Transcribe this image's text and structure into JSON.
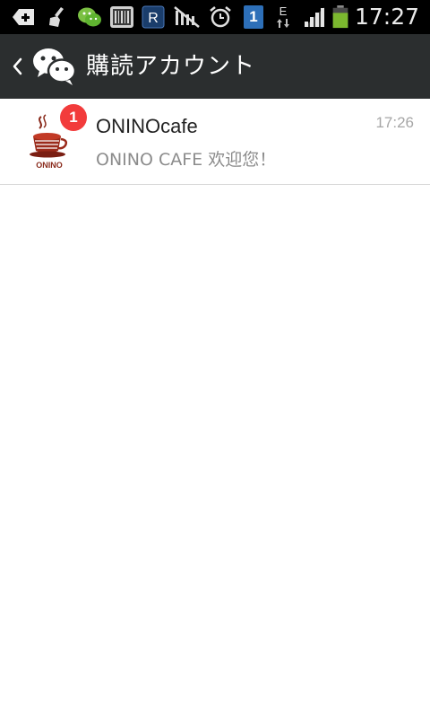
{
  "status_bar": {
    "time": "17:27",
    "icons": [
      "android-icon",
      "broom-icon",
      "wechat-icon",
      "barcode-icon",
      "r-app-icon",
      "no-signal-icon",
      "alarm-icon",
      "notification-one-icon",
      "edge-data-icon",
      "signal-icon",
      "battery-icon"
    ],
    "notification_count": "1",
    "network_type": "E",
    "battery_color": "#7cb82f"
  },
  "action_bar": {
    "title": "購読アカウント",
    "back_icon": "chevron-left-icon",
    "logo_icon": "wechat-logo-icon",
    "background": "#2b2e2f"
  },
  "list": {
    "items": [
      {
        "name": "ONINOcafe",
        "preview": "ONINO CAFE 欢迎您！",
        "time": "17:26",
        "unread": "1",
        "avatar_text": "ONINO"
      }
    ]
  },
  "colors": {
    "badge": "#f23b3b",
    "divider": "#d7d7d7"
  }
}
